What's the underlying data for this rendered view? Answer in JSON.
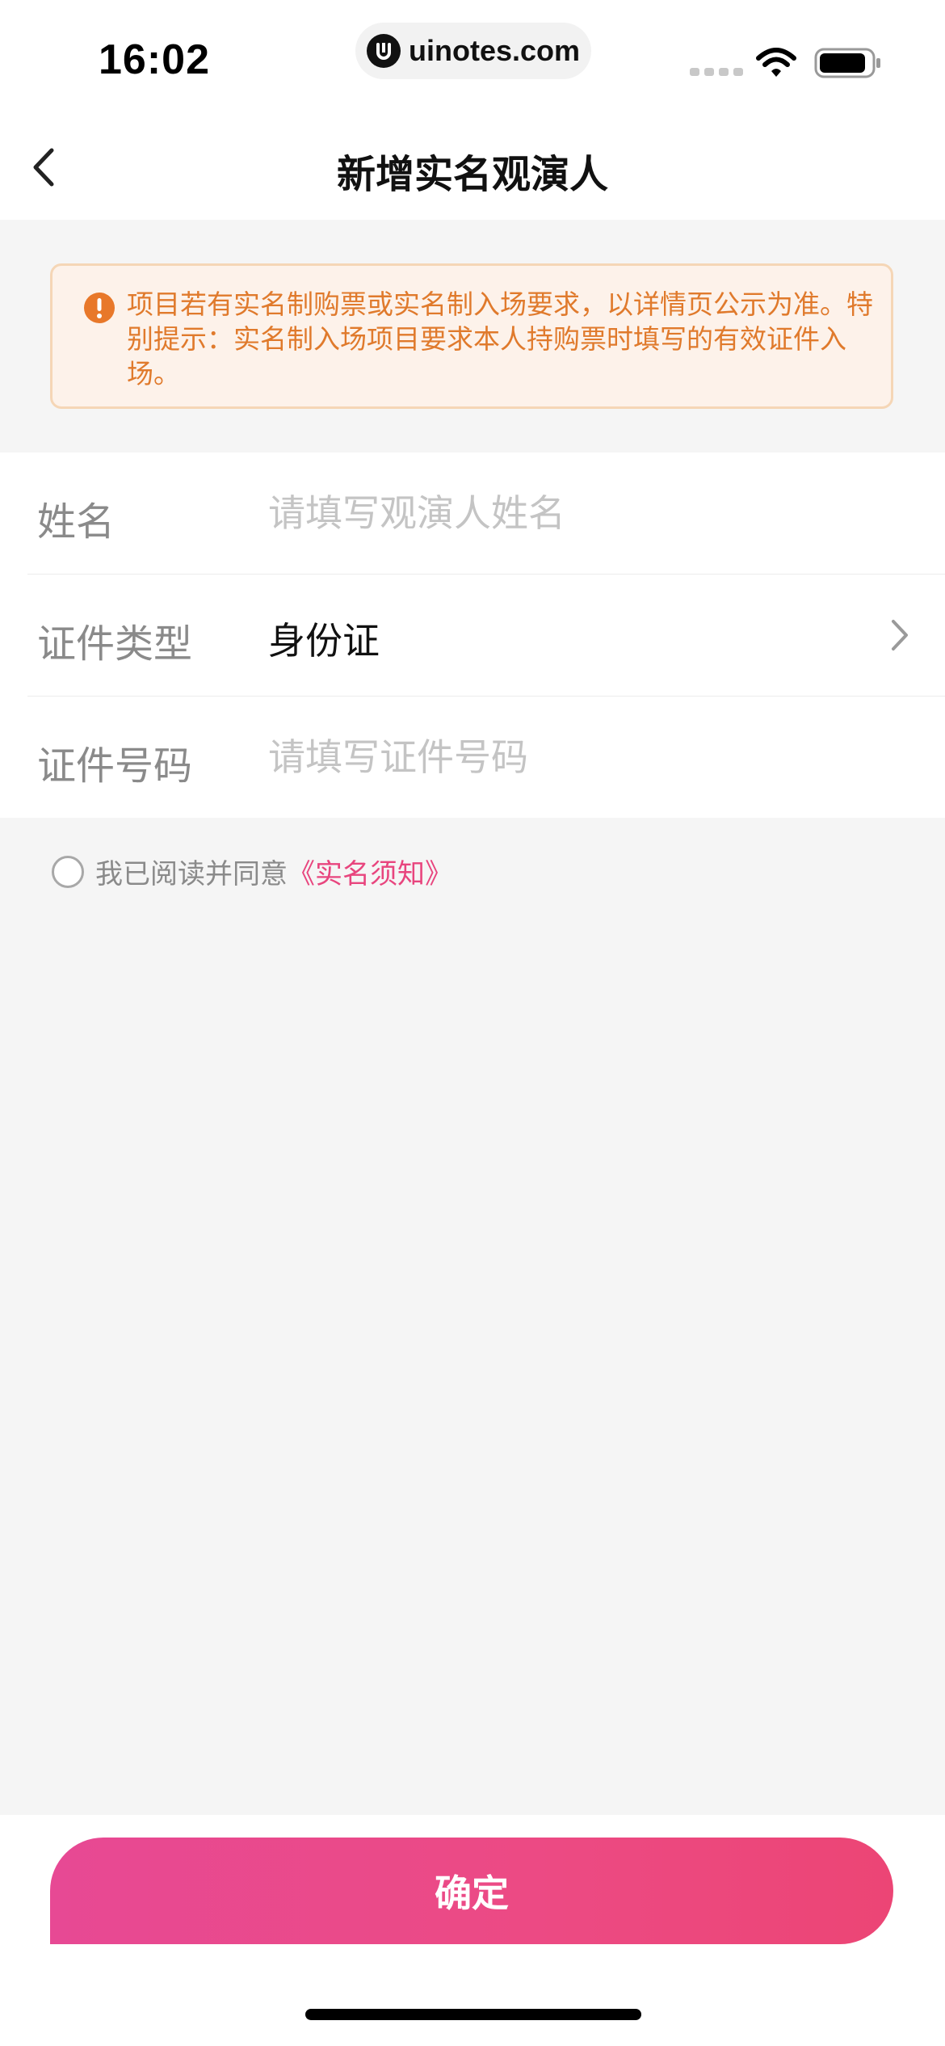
{
  "status_bar": {
    "time": "16:02",
    "url": "uinotes.com",
    "icons": [
      "signal-icon",
      "wifi-icon",
      "battery-icon"
    ]
  },
  "nav": {
    "title": "新增实名观演人",
    "back_icon": "chevron-left-icon"
  },
  "notice": {
    "icon": "exclamation-circle-icon",
    "text": "项目若有实名制购票或实名制入场要求，以详情页公示为准。特别提示：实名制入场项目要求本人持购票时填写的有效证件入场。",
    "color": "#e07a2c"
  },
  "form": {
    "name": {
      "label": "姓名",
      "placeholder": "请填写观演人姓名",
      "value": ""
    },
    "id_type": {
      "label": "证件类型",
      "value": "身份证"
    },
    "id_number": {
      "label": "证件号码",
      "placeholder": "请填写证件号码",
      "value": ""
    }
  },
  "agreement": {
    "checked": false,
    "text": "我已阅读并同意",
    "link": "《实名须知》",
    "link_color": "#e8457e"
  },
  "confirm": {
    "label": "确定",
    "gradient": [
      "#e74994",
      "#ec4575"
    ]
  }
}
